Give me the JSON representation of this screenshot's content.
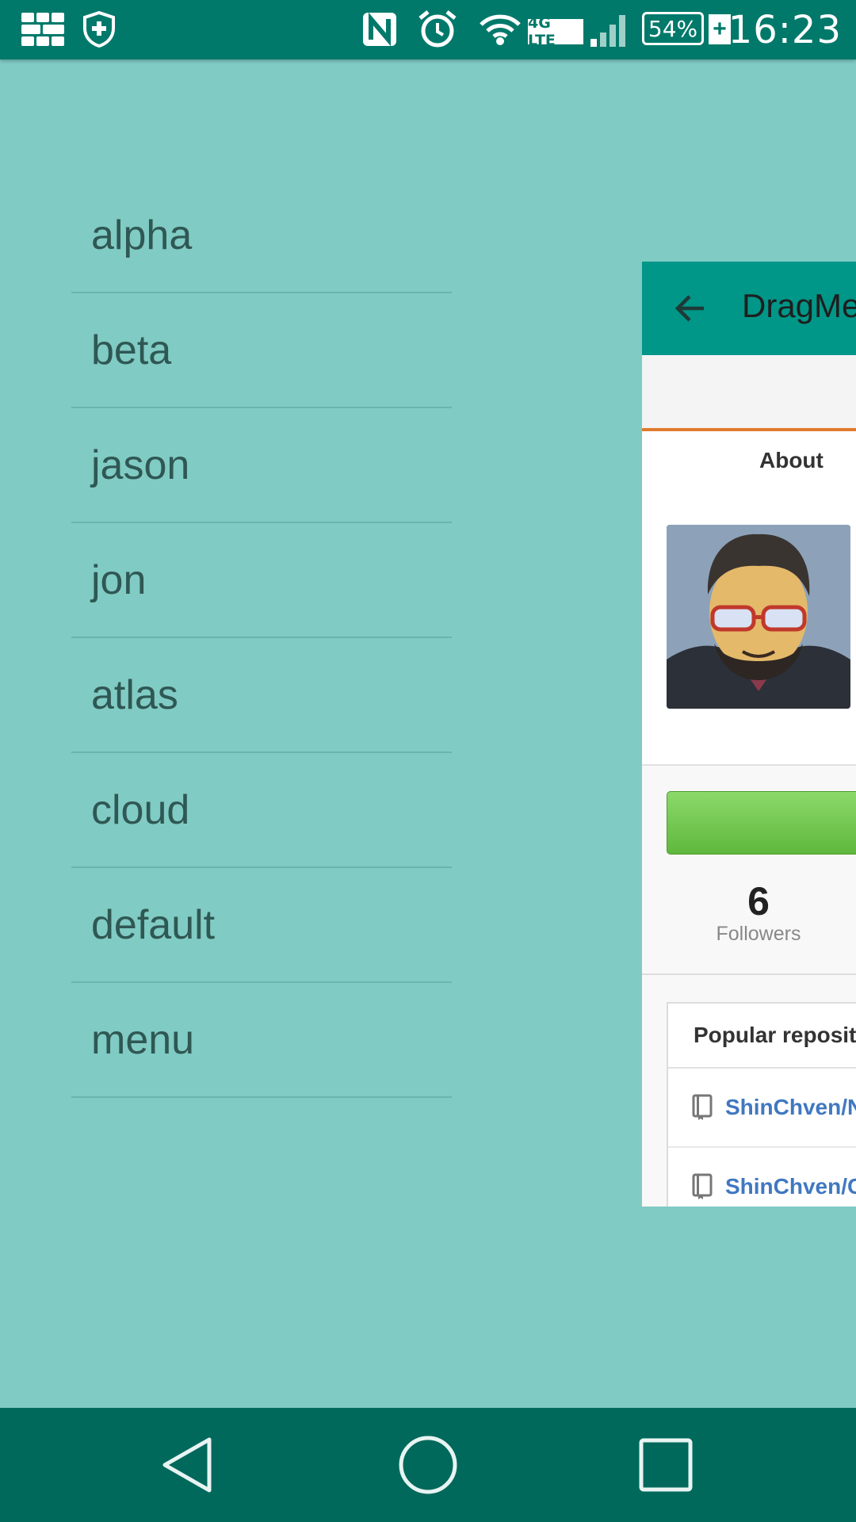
{
  "status_bar": {
    "time": "16:23",
    "battery": "54%",
    "battery_plus": "+",
    "network": "4G LTE",
    "icons": [
      "grid-icon",
      "shield-icon",
      "nfc-icon",
      "alarm-icon",
      "wifi-icon",
      "network-type-icon",
      "signal-icon",
      "battery-icon",
      "charging-icon"
    ]
  },
  "menu": {
    "items": [
      "alpha",
      "beta",
      "jason",
      "jon",
      "atlas",
      "cloud",
      "default",
      "menu"
    ]
  },
  "card": {
    "title": "DragMe",
    "tab_about": "About",
    "followers_count": "6",
    "followers_label": "Followers",
    "repos_header": "Popular repositories",
    "repos": [
      "ShinChven/N",
      "ShinChven/C"
    ]
  },
  "colors": {
    "background": "#80cbc4",
    "status_bar": "#00796b",
    "toolbar": "#009688",
    "nav_bar": "#00695c",
    "accent_orange": "#e07a2e",
    "button_green": "#6cc24a",
    "link_blue": "#4078c0"
  },
  "nav_bar": {
    "buttons": [
      "back-icon",
      "home-icon",
      "recents-icon"
    ]
  }
}
